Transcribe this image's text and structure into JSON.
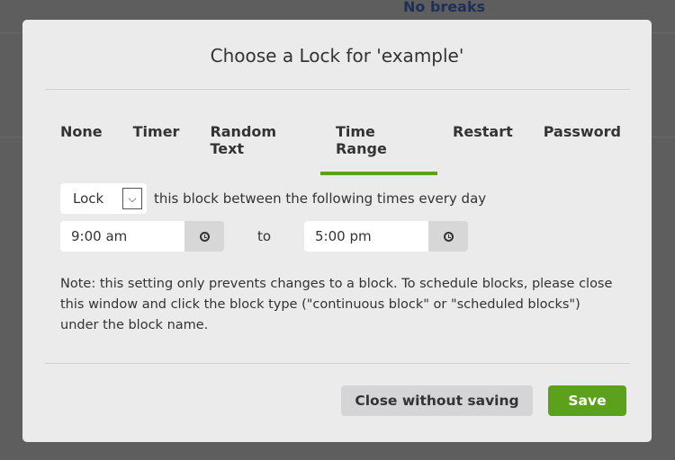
{
  "background": {
    "text": "No breaks"
  },
  "modal": {
    "title": "Choose a Lock for 'example'",
    "tabs": [
      {
        "label": "None"
      },
      {
        "label": "Timer"
      },
      {
        "label": "Random Text"
      },
      {
        "label": "Time Range",
        "active": true
      },
      {
        "label": "Restart"
      },
      {
        "label": "Password"
      }
    ],
    "lock_select": "Lock",
    "lock_text": "this block between the following times every day",
    "start_time": "9:00 am",
    "to_label": "to",
    "end_time": "5:00 pm",
    "note": "Note: this setting only prevents changes to a block. To schedule blocks, please close this window and click the block type (\"continuous block\" or \"scheduled blocks\") under the block name.",
    "close_label": "Close without saving",
    "save_label": "Save"
  },
  "colors": {
    "accent": "#5ba11c"
  }
}
